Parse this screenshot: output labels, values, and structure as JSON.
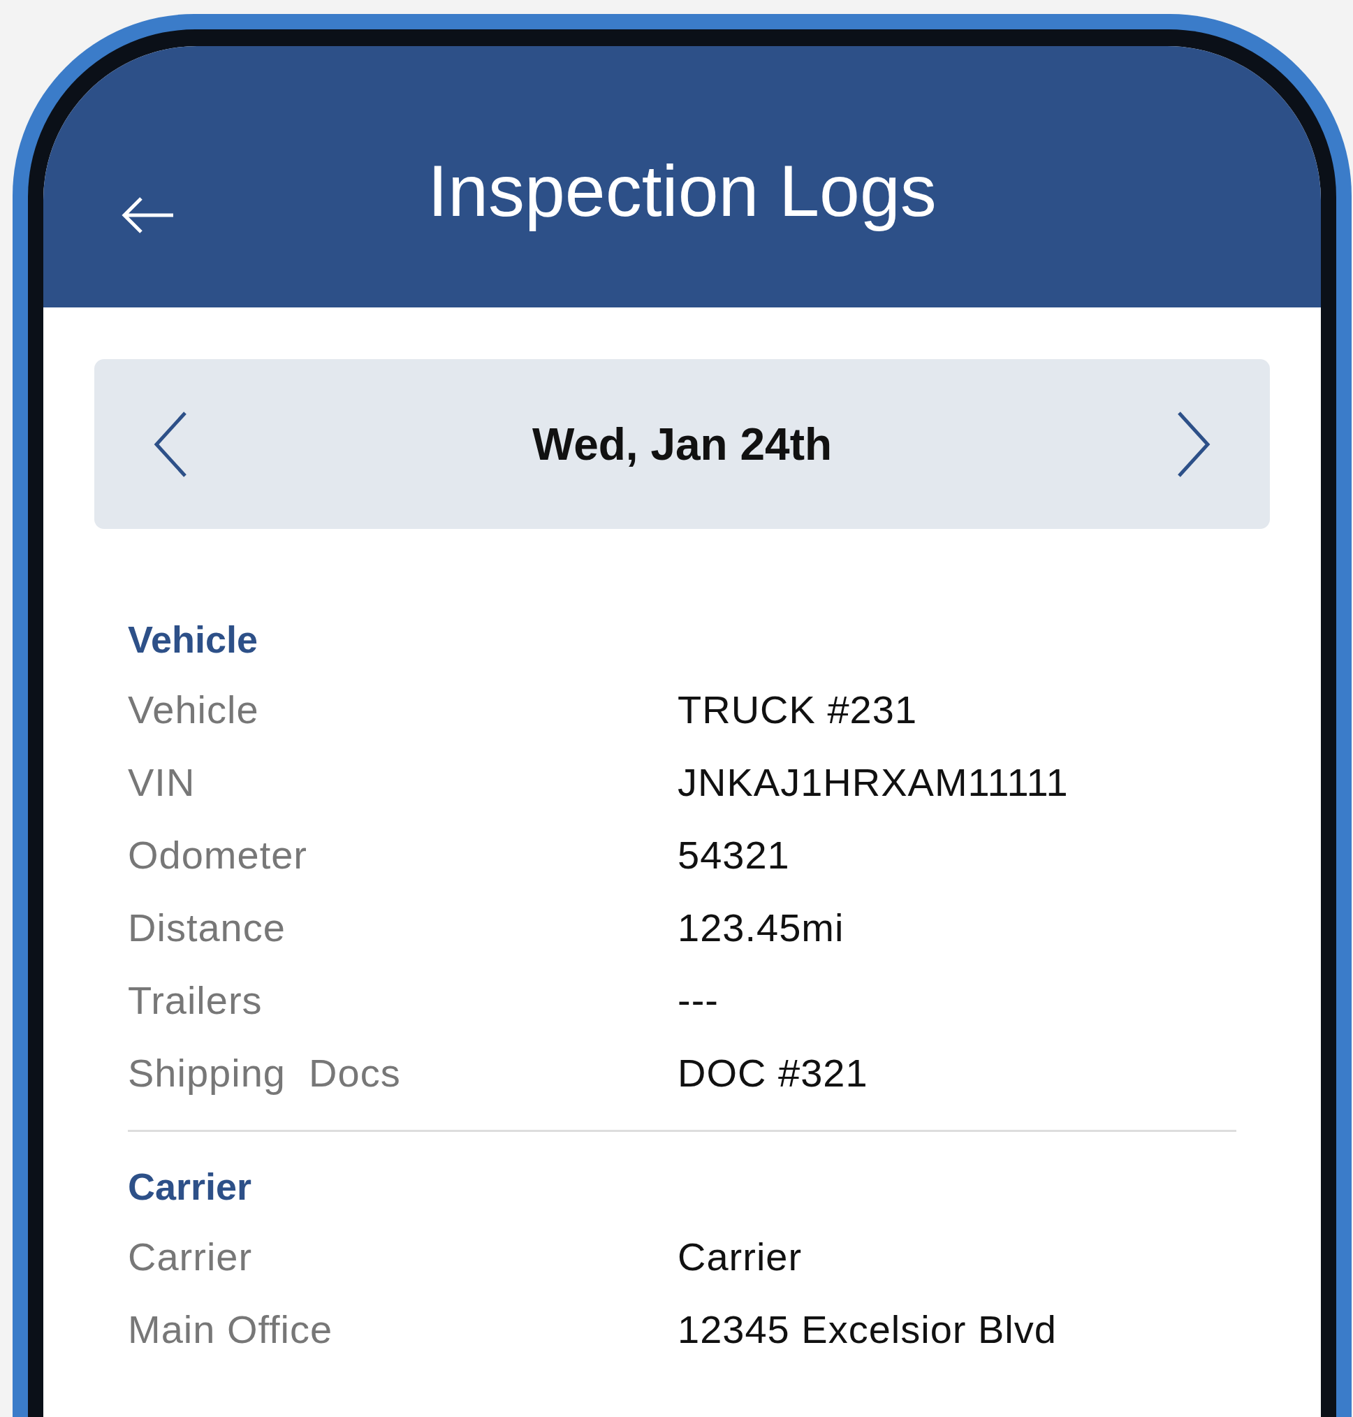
{
  "header": {
    "title": "Inspection Logs"
  },
  "date_selector": {
    "label": "Wed, Jan 24th"
  },
  "sections": [
    {
      "heading": "Vehicle",
      "rows": [
        {
          "label": "Vehicle",
          "value": "TRUCK #231"
        },
        {
          "label": "VIN",
          "value": "JNKAJ1HRXAM11111"
        },
        {
          "label": "Odometer",
          "value": "54321"
        },
        {
          "label": "Distance",
          "value": "123.45mi"
        },
        {
          "label": "Trailers",
          "value": "---"
        },
        {
          "label": "Shipping  Docs",
          "value": "DOC #321"
        }
      ]
    },
    {
      "heading": "Carrier",
      "rows": [
        {
          "label": "Carrier",
          "value": "Carrier"
        },
        {
          "label": "Main Office",
          "value": "12345 Excelsior Blvd"
        }
      ]
    }
  ]
}
